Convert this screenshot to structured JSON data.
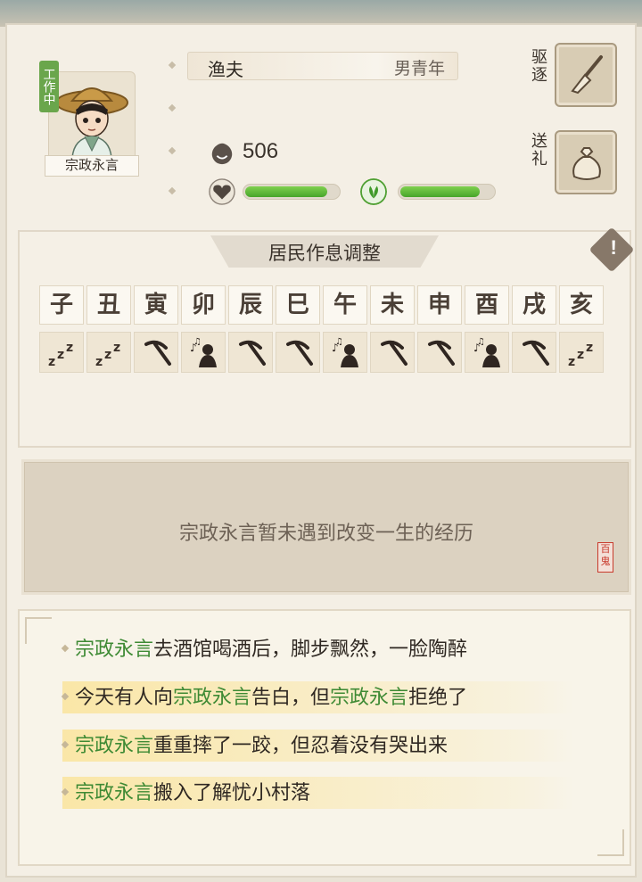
{
  "resident": {
    "name": "宗政永言",
    "status_tag": "工作中",
    "job": "渔夫",
    "type": "男青年",
    "coins": "506",
    "health_pct": 0.88,
    "happiness_pct": 0.86
  },
  "actions": {
    "expel_label": "驱逐",
    "gift_label": "送礼"
  },
  "schedule": {
    "title": "居民作息调整",
    "warn_icon": "!",
    "hours": [
      "子",
      "丑",
      "寅",
      "卯",
      "辰",
      "巳",
      "午",
      "未",
      "申",
      "酉",
      "戌",
      "亥"
    ],
    "activities": [
      "sleep",
      "sleep",
      "work",
      "leisure",
      "work",
      "work",
      "leisure",
      "work",
      "work",
      "leisure",
      "work",
      "sleep"
    ]
  },
  "experience": {
    "text": "宗政永言暂未遇到改变一生的经历",
    "seal": "百鬼"
  },
  "log": [
    {
      "highlight": false,
      "parts": [
        {
          "t": "宗政永言",
          "name": true
        },
        {
          "t": "去酒馆喝酒后，脚步飘然，一脸陶醉",
          "name": false
        }
      ]
    },
    {
      "highlight": true,
      "parts": [
        {
          "t": "今天有人向",
          "name": false
        },
        {
          "t": "宗政永言",
          "name": true
        },
        {
          "t": "告白，但",
          "name": false
        },
        {
          "t": "宗政永言",
          "name": true
        },
        {
          "t": "拒绝了",
          "name": false
        }
      ]
    },
    {
      "highlight": true,
      "parts": [
        {
          "t": "宗政永言",
          "name": true
        },
        {
          "t": "重重摔了一跤，但忍着没有哭出来",
          "name": false
        }
      ]
    },
    {
      "highlight": true,
      "parts": [
        {
          "t": "宗政永言",
          "name": true
        },
        {
          "t": "搬入了解忧小村落",
          "name": false
        }
      ]
    }
  ],
  "colors": {
    "accent_green": "#3e8a34",
    "bar_green": "#47a52a",
    "highlight": "#fae5a0"
  }
}
